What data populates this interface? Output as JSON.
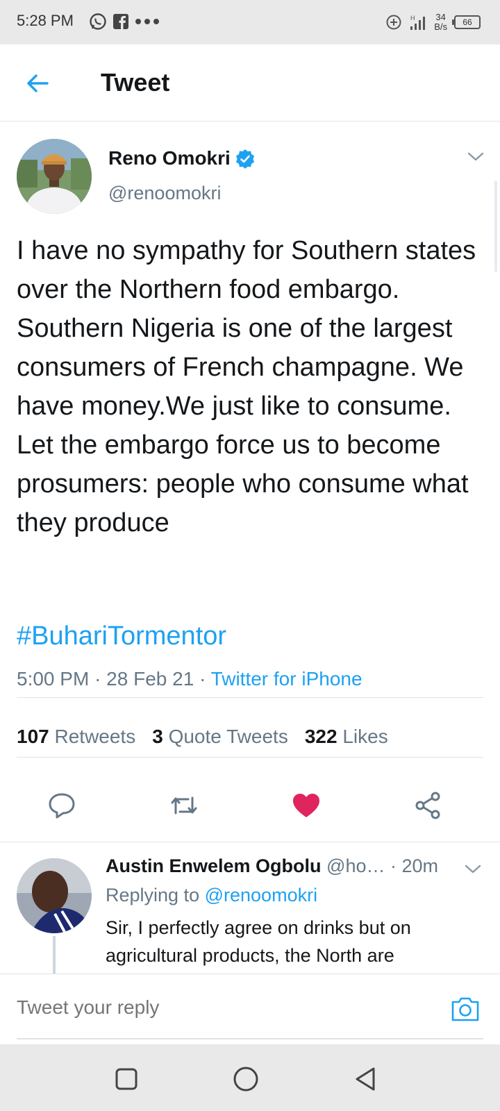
{
  "status_bar": {
    "time": "5:28 PM",
    "speed_value": "34",
    "speed_unit": "B/s",
    "battery": "66"
  },
  "header": {
    "title": "Tweet"
  },
  "tweet": {
    "author_name": "Reno Omokri",
    "author_handle": "@renoomokri",
    "text": "I have no sympathy for Southern states over the Northern food embargo. Southern Nigeria is one of the largest consumers of French champagne. We have money.We just like to consume. Let the embargo force us to become prosumers: people who consume what they produce",
    "hashtag": "#BuhariTormentor",
    "time": "5:00 PM",
    "date": "28 Feb 21",
    "source": "Twitter for iPhone",
    "retweets_count": "107",
    "retweets_label": "Retweets",
    "quotes_count": "3",
    "quotes_label": "Quote Tweets",
    "likes_count": "322",
    "likes_label": "Likes"
  },
  "reply": {
    "author_name": "Austin Enwelem Ogbolu",
    "author_handle": "@ho…",
    "time": "20m",
    "replying_prefix": "Replying to",
    "replying_to": "@renoomokri",
    "text": "Sir, I perfectly agree on drinks but on agricultural products, the North are"
  },
  "composer": {
    "placeholder": "Tweet your reply"
  },
  "colors": {
    "accent": "#1da1f2",
    "like": "#e0245e",
    "secondary_text": "#657786"
  }
}
